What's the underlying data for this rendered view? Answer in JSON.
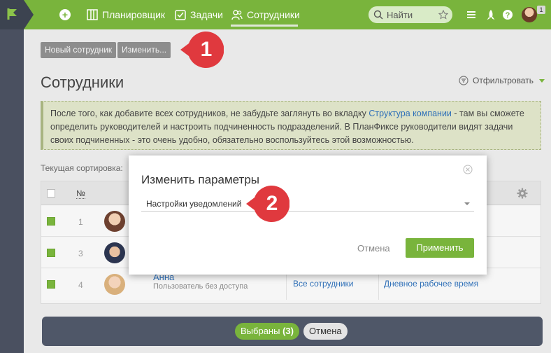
{
  "nav": {
    "planner": "Планировщик",
    "tasks": "Задачи",
    "employees": "Сотрудники"
  },
  "search": {
    "label": "Найти"
  },
  "profile": {
    "badge": "1"
  },
  "toolbar": {
    "new_employee": "Новый сотрудник",
    "edit": "Изменить..."
  },
  "page": {
    "title": "Сотрудники",
    "filter": "Отфильтровать"
  },
  "notice": {
    "text_before": "После того, как добавите всех сотрудников, не забудьте заглянуть во вкладку ",
    "link": "Структура компании",
    "text_after": " - там вы сможете определить руководителей и настроить подчиненность подразделений. В ПланФиксе руководители видят задачи своих подчиненных - это очень удобно, обязательно воспользуйтесь этой возможностью."
  },
  "sort": {
    "label": "Текущая сортировка:"
  },
  "table": {
    "num_header": "№",
    "rows": [
      {
        "num": "1",
        "name": "",
        "sub": "",
        "group": "",
        "schedule": ""
      },
      {
        "num": "3",
        "name": "",
        "sub": "",
        "group": "",
        "schedule": ""
      },
      {
        "num": "4",
        "name": "Анна",
        "sub": "Пользователь без доступа",
        "group": "Все сотрудники",
        "schedule": "Дневное рабочее время"
      }
    ]
  },
  "bottom": {
    "selected_label": "Выбраны",
    "selected_count": "(3)",
    "cancel": "Отмена"
  },
  "modal": {
    "title": "Изменить параметры",
    "select_value": "Настройки уведомлений",
    "cancel": "Отмена",
    "apply": "Применить"
  },
  "markers": {
    "one": "1",
    "two": "2"
  },
  "colors": {
    "accent": "#79b43c",
    "marker": "#e0393e",
    "link": "#2f70b8"
  }
}
